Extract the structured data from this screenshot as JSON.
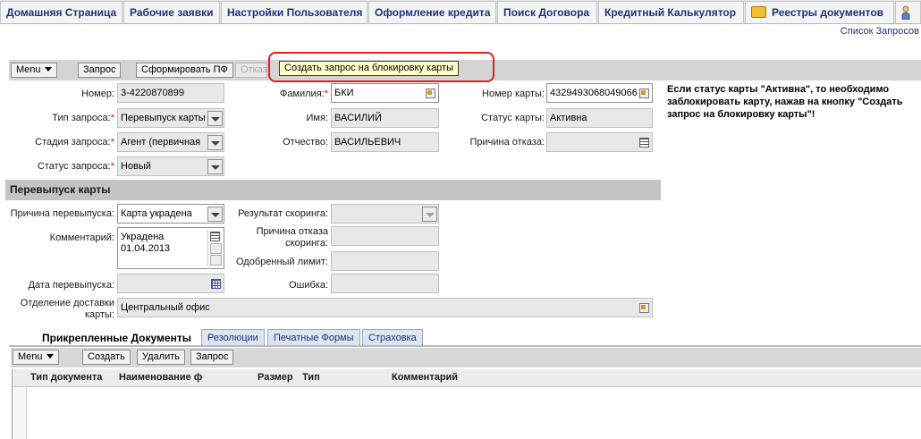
{
  "nav": {
    "tabs": [
      "Домашняя Страница",
      "Рабочие заявки",
      "Настройки Пользователя",
      "Оформление кредита",
      "Поиск Договора",
      "Кредитный Калькулятор",
      "Реестры документов"
    ],
    "link": "Список Запросов"
  },
  "toolbar": {
    "menu_label": "Menu",
    "request_label": "Запрос",
    "form_pf_label": "Сформировать ПФ",
    "reject_label": "Отказ",
    "block_card_label": "Создать запрос на блокировку карты"
  },
  "form": {
    "number_label": "Номер:",
    "number_value": "3-4220870899",
    "request_type_label": "Тип запроса:",
    "request_type_value": "Перевыпуск карты",
    "stage_label": "Стадия запроса:",
    "stage_value": "Агент (первичная",
    "status_label": "Статус запроса:",
    "status_value": "Новый",
    "lastname_label": "Фамилия:",
    "lastname_value": "БКИ",
    "firstname_label": "Имя:",
    "firstname_value": "ВАСИЛИЙ",
    "patronymic_label": "Отчество:",
    "patronymic_value": "ВАСИЛЬЕВИЧ",
    "card_number_label": "Номер карты:",
    "card_number_value": "4329493068049066",
    "card_status_label": "Статус карты:",
    "card_status_value": "Активна",
    "reject_reason_label": "Причина отказа:",
    "reject_reason_value": ""
  },
  "note": "Если статус карты \"Активна\", то необходимо заблокировать карту, нажав на кнопку \"Создать запрос на блокировку карты\"!",
  "reissue": {
    "section_title": "Перевыпуск карты",
    "reason_label": "Причина перевыпуска:",
    "reason_value": "Карта украдена",
    "comment_label": "Комментарий:",
    "comment_line1": "Украдена",
    "comment_line2": "01.04.2013",
    "reissue_date_label": "Дата перевыпуска:",
    "reissue_date_value": "",
    "delivery_label_line1": "Отделение доставки",
    "delivery_label_line2": "карты:",
    "delivery_value": "Центральный офис",
    "scoring_result_label": "Результат скоринга:",
    "scoring_result_value": "",
    "scoring_reject_label_line1": "Причина отказа",
    "scoring_reject_label_line2": "скоринга:",
    "approved_limit_label": "Одобренный лимит:",
    "error_label": "Ошибка:"
  },
  "bottom_tabs": [
    "Прикрепленные Документы",
    "Резолюции",
    "Печатные Формы",
    "Страховка"
  ],
  "docs_toolbar": {
    "menu_label": "Menu",
    "create_label": "Создать",
    "delete_label": "Удалить",
    "request_label": "Запрос"
  },
  "grid_columns": [
    "Тип документа",
    "Наименование ф",
    "Размер",
    "Тип",
    "Комментарий"
  ]
}
